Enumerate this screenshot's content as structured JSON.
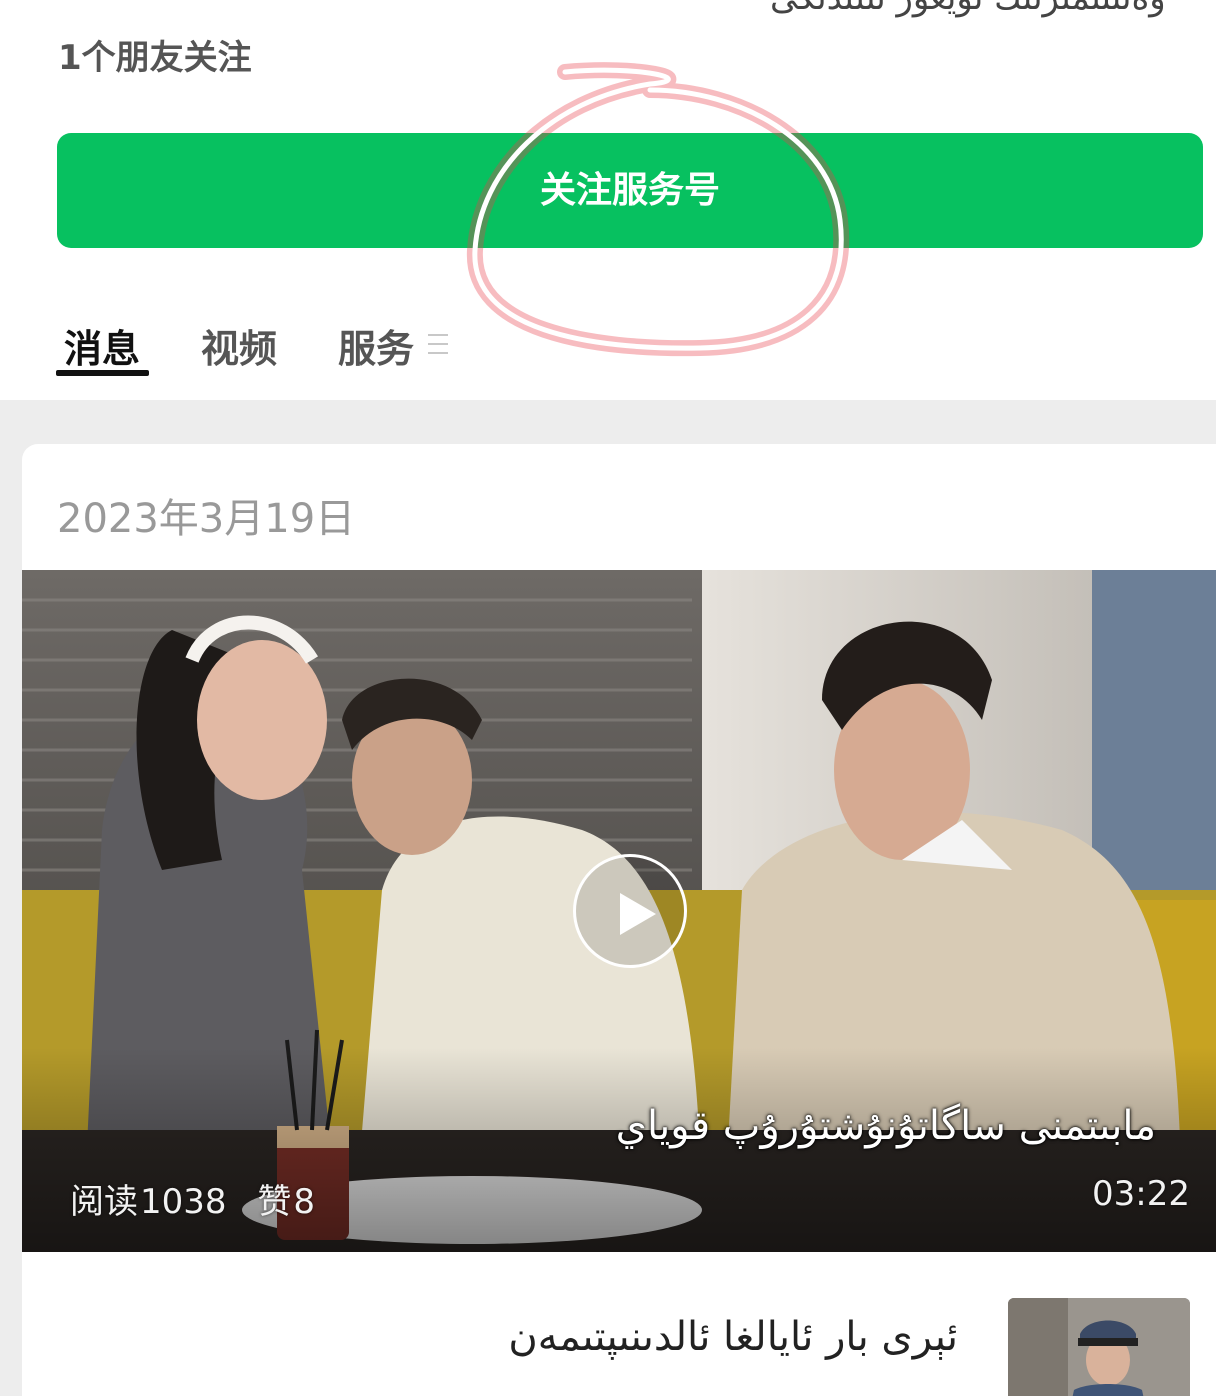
{
  "header": {
    "cut_text": "ۋەتىنىمىزنىڭ ئۇيغۇر تىلىدىكى",
    "friends_following": "1个朋友关注"
  },
  "follow_button": {
    "label": "关注服务号"
  },
  "tabs": [
    {
      "label": "消息",
      "active": true
    },
    {
      "label": "视频",
      "active": false
    },
    {
      "label": "服务",
      "active": false
    }
  ],
  "feed": {
    "date": "2023年3月19日",
    "video": {
      "caption": "مابىتمنى ساگاتۇنۇشتۇرۇپ قوياي",
      "reads_label": "阅读",
      "reads": "1038",
      "likes_label": "赞",
      "likes": "8",
      "duration": "03:22"
    },
    "article": {
      "title": "ئېرى بار ئايالغا ئالدىنىپتىمەن"
    }
  },
  "colors": {
    "accent": "#07c160",
    "annotation_ring": "#e8404a"
  }
}
